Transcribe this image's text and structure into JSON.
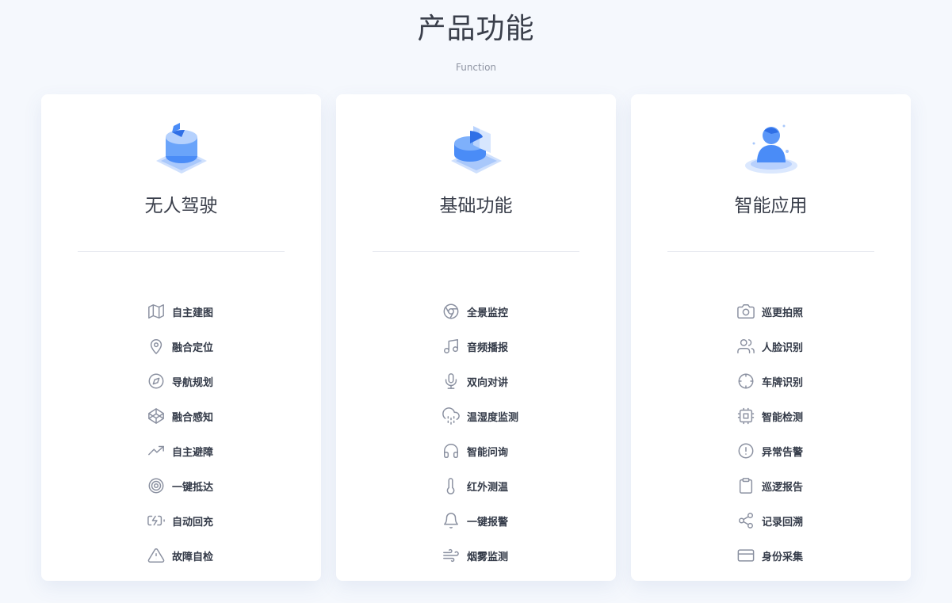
{
  "header": {
    "title": "产品功能",
    "subtitle": "Function"
  },
  "cards": [
    {
      "title": "无人驾驶",
      "features": [
        {
          "label": "自主建图",
          "icon": "map-icon"
        },
        {
          "label": "融合定位",
          "icon": "location-pin-icon"
        },
        {
          "label": "导航规划",
          "icon": "compass-icon"
        },
        {
          "label": "融合感知",
          "icon": "codepen-icon"
        },
        {
          "label": "自主避障",
          "icon": "trending-up-icon"
        },
        {
          "label": "一键抵达",
          "icon": "target-icon"
        },
        {
          "label": "自动回充",
          "icon": "battery-charging-icon"
        },
        {
          "label": "故障自检",
          "icon": "warning-triangle-icon"
        }
      ]
    },
    {
      "title": "基础功能",
      "features": [
        {
          "label": "全景监控",
          "icon": "chrome-icon"
        },
        {
          "label": "音频播报",
          "icon": "music-icon"
        },
        {
          "label": "双向对讲",
          "icon": "microphone-icon"
        },
        {
          "label": "温湿度监测",
          "icon": "cloud-drizzle-icon"
        },
        {
          "label": "智能问询",
          "icon": "headphones-icon"
        },
        {
          "label": "红外测温",
          "icon": "thermometer-icon"
        },
        {
          "label": "一键报警",
          "icon": "bell-icon"
        },
        {
          "label": "烟雾监测",
          "icon": "wind-icon"
        }
      ]
    },
    {
      "title": "智能应用",
      "features": [
        {
          "label": "巡更拍照",
          "icon": "camera-icon"
        },
        {
          "label": "人脸识别",
          "icon": "users-icon"
        },
        {
          "label": "车牌识别",
          "icon": "crosshair-icon"
        },
        {
          "label": "智能检测",
          "icon": "cpu-icon"
        },
        {
          "label": "异常告警",
          "icon": "alert-circle-icon"
        },
        {
          "label": "巡逻报告",
          "icon": "clipboard-icon"
        },
        {
          "label": "记录回溯",
          "icon": "share-icon"
        },
        {
          "label": "身份采集",
          "icon": "credit-card-icon"
        }
      ]
    }
  ],
  "colors": {
    "background": "#f5f8fd",
    "accent": "#4a8cf7",
    "icon": "#8a90a0"
  }
}
